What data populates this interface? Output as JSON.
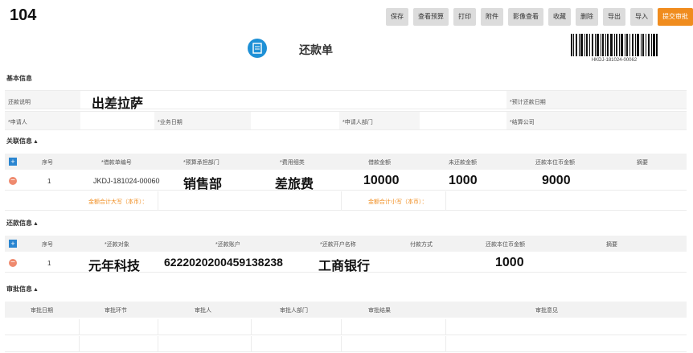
{
  "header": {
    "number": "104"
  },
  "toolbar": {
    "buttons": [
      "保存",
      "查看预算",
      "打印",
      "附件",
      "影像查看",
      "收藏",
      "删除",
      "导出",
      "导入"
    ],
    "submit": "提交审批"
  },
  "doc": {
    "title": "还款单",
    "barcode_text": "HKDJ-181024-00062",
    "icon": "document-icon"
  },
  "basic": {
    "section": "基本信息",
    "repay_note_label": "还款说明",
    "repay_note_value": "出差拉萨",
    "expected_date_label": "*预计还款日期",
    "applicant_label": "*申请人",
    "biz_date_label": "*业务日期",
    "applicant_dept_label": "*申请人部门",
    "settle_company_label": "*结算公司"
  },
  "related": {
    "section": "关联信息",
    "headers": [
      "序号",
      "*借款单编号",
      "*预算承担部门",
      "*费用细类",
      "借款金额",
      "未还款金额",
      "还款本位币金额",
      "摘要"
    ],
    "row": {
      "seq": "1",
      "loan_no": "JKDJ-181024-00060",
      "dept": "销售部",
      "category": "差旅费",
      "loan_amount": "10000",
      "unpaid": "1000",
      "repay_amount": "9000"
    },
    "total_upper_label": "金额合计大写（本币）：",
    "total_lower_label": "金额合计小写（本币）："
  },
  "repay": {
    "section": "还款信息",
    "headers": [
      "序号",
      "*还款对象",
      "*还款账户",
      "*还款开户名称",
      "付款方式",
      "还款本位币金额",
      "摘要"
    ],
    "row": {
      "seq": "1",
      "target": "元年科技",
      "account": "6222020200459138238",
      "bank": "工商银行",
      "amount": "1000"
    }
  },
  "approval": {
    "section": "审批信息",
    "headers": [
      "审批日期",
      "审批环节",
      "审批人",
      "审批人部门",
      "审批结果",
      "审批意见"
    ]
  },
  "colors": {
    "accent": "#f08c1e",
    "blue": "#2a85d0",
    "remove": "#ef8a6e"
  }
}
